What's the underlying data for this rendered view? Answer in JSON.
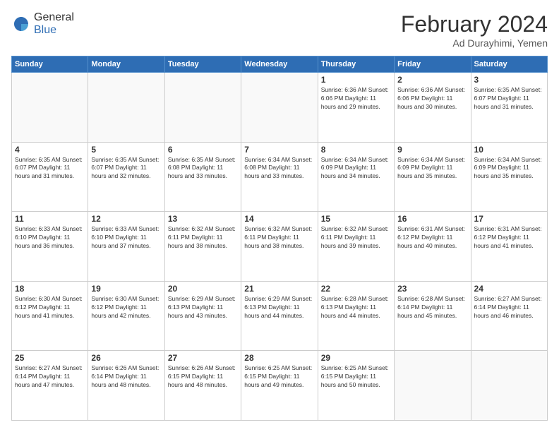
{
  "header": {
    "logo": {
      "general": "General",
      "blue": "Blue"
    },
    "title": "February 2024",
    "location": "Ad Durayhimi, Yemen"
  },
  "weekdays": [
    "Sunday",
    "Monday",
    "Tuesday",
    "Wednesday",
    "Thursday",
    "Friday",
    "Saturday"
  ],
  "weeks": [
    [
      {
        "day": "",
        "info": ""
      },
      {
        "day": "",
        "info": ""
      },
      {
        "day": "",
        "info": ""
      },
      {
        "day": "",
        "info": ""
      },
      {
        "day": "1",
        "info": "Sunrise: 6:36 AM\nSunset: 6:06 PM\nDaylight: 11 hours and 29 minutes."
      },
      {
        "day": "2",
        "info": "Sunrise: 6:36 AM\nSunset: 6:06 PM\nDaylight: 11 hours and 30 minutes."
      },
      {
        "day": "3",
        "info": "Sunrise: 6:35 AM\nSunset: 6:07 PM\nDaylight: 11 hours and 31 minutes."
      }
    ],
    [
      {
        "day": "4",
        "info": "Sunrise: 6:35 AM\nSunset: 6:07 PM\nDaylight: 11 hours and 31 minutes."
      },
      {
        "day": "5",
        "info": "Sunrise: 6:35 AM\nSunset: 6:07 PM\nDaylight: 11 hours and 32 minutes."
      },
      {
        "day": "6",
        "info": "Sunrise: 6:35 AM\nSunset: 6:08 PM\nDaylight: 11 hours and 33 minutes."
      },
      {
        "day": "7",
        "info": "Sunrise: 6:34 AM\nSunset: 6:08 PM\nDaylight: 11 hours and 33 minutes."
      },
      {
        "day": "8",
        "info": "Sunrise: 6:34 AM\nSunset: 6:09 PM\nDaylight: 11 hours and 34 minutes."
      },
      {
        "day": "9",
        "info": "Sunrise: 6:34 AM\nSunset: 6:09 PM\nDaylight: 11 hours and 35 minutes."
      },
      {
        "day": "10",
        "info": "Sunrise: 6:34 AM\nSunset: 6:09 PM\nDaylight: 11 hours and 35 minutes."
      }
    ],
    [
      {
        "day": "11",
        "info": "Sunrise: 6:33 AM\nSunset: 6:10 PM\nDaylight: 11 hours and 36 minutes."
      },
      {
        "day": "12",
        "info": "Sunrise: 6:33 AM\nSunset: 6:10 PM\nDaylight: 11 hours and 37 minutes."
      },
      {
        "day": "13",
        "info": "Sunrise: 6:32 AM\nSunset: 6:11 PM\nDaylight: 11 hours and 38 minutes."
      },
      {
        "day": "14",
        "info": "Sunrise: 6:32 AM\nSunset: 6:11 PM\nDaylight: 11 hours and 38 minutes."
      },
      {
        "day": "15",
        "info": "Sunrise: 6:32 AM\nSunset: 6:11 PM\nDaylight: 11 hours and 39 minutes."
      },
      {
        "day": "16",
        "info": "Sunrise: 6:31 AM\nSunset: 6:12 PM\nDaylight: 11 hours and 40 minutes."
      },
      {
        "day": "17",
        "info": "Sunrise: 6:31 AM\nSunset: 6:12 PM\nDaylight: 11 hours and 41 minutes."
      }
    ],
    [
      {
        "day": "18",
        "info": "Sunrise: 6:30 AM\nSunset: 6:12 PM\nDaylight: 11 hours and 41 minutes."
      },
      {
        "day": "19",
        "info": "Sunrise: 6:30 AM\nSunset: 6:12 PM\nDaylight: 11 hours and 42 minutes."
      },
      {
        "day": "20",
        "info": "Sunrise: 6:29 AM\nSunset: 6:13 PM\nDaylight: 11 hours and 43 minutes."
      },
      {
        "day": "21",
        "info": "Sunrise: 6:29 AM\nSunset: 6:13 PM\nDaylight: 11 hours and 44 minutes."
      },
      {
        "day": "22",
        "info": "Sunrise: 6:28 AM\nSunset: 6:13 PM\nDaylight: 11 hours and 44 minutes."
      },
      {
        "day": "23",
        "info": "Sunrise: 6:28 AM\nSunset: 6:14 PM\nDaylight: 11 hours and 45 minutes."
      },
      {
        "day": "24",
        "info": "Sunrise: 6:27 AM\nSunset: 6:14 PM\nDaylight: 11 hours and 46 minutes."
      }
    ],
    [
      {
        "day": "25",
        "info": "Sunrise: 6:27 AM\nSunset: 6:14 PM\nDaylight: 11 hours and 47 minutes."
      },
      {
        "day": "26",
        "info": "Sunrise: 6:26 AM\nSunset: 6:14 PM\nDaylight: 11 hours and 48 minutes."
      },
      {
        "day": "27",
        "info": "Sunrise: 6:26 AM\nSunset: 6:15 PM\nDaylight: 11 hours and 48 minutes."
      },
      {
        "day": "28",
        "info": "Sunrise: 6:25 AM\nSunset: 6:15 PM\nDaylight: 11 hours and 49 minutes."
      },
      {
        "day": "29",
        "info": "Sunrise: 6:25 AM\nSunset: 6:15 PM\nDaylight: 11 hours and 50 minutes."
      },
      {
        "day": "",
        "info": ""
      },
      {
        "day": "",
        "info": ""
      }
    ]
  ]
}
